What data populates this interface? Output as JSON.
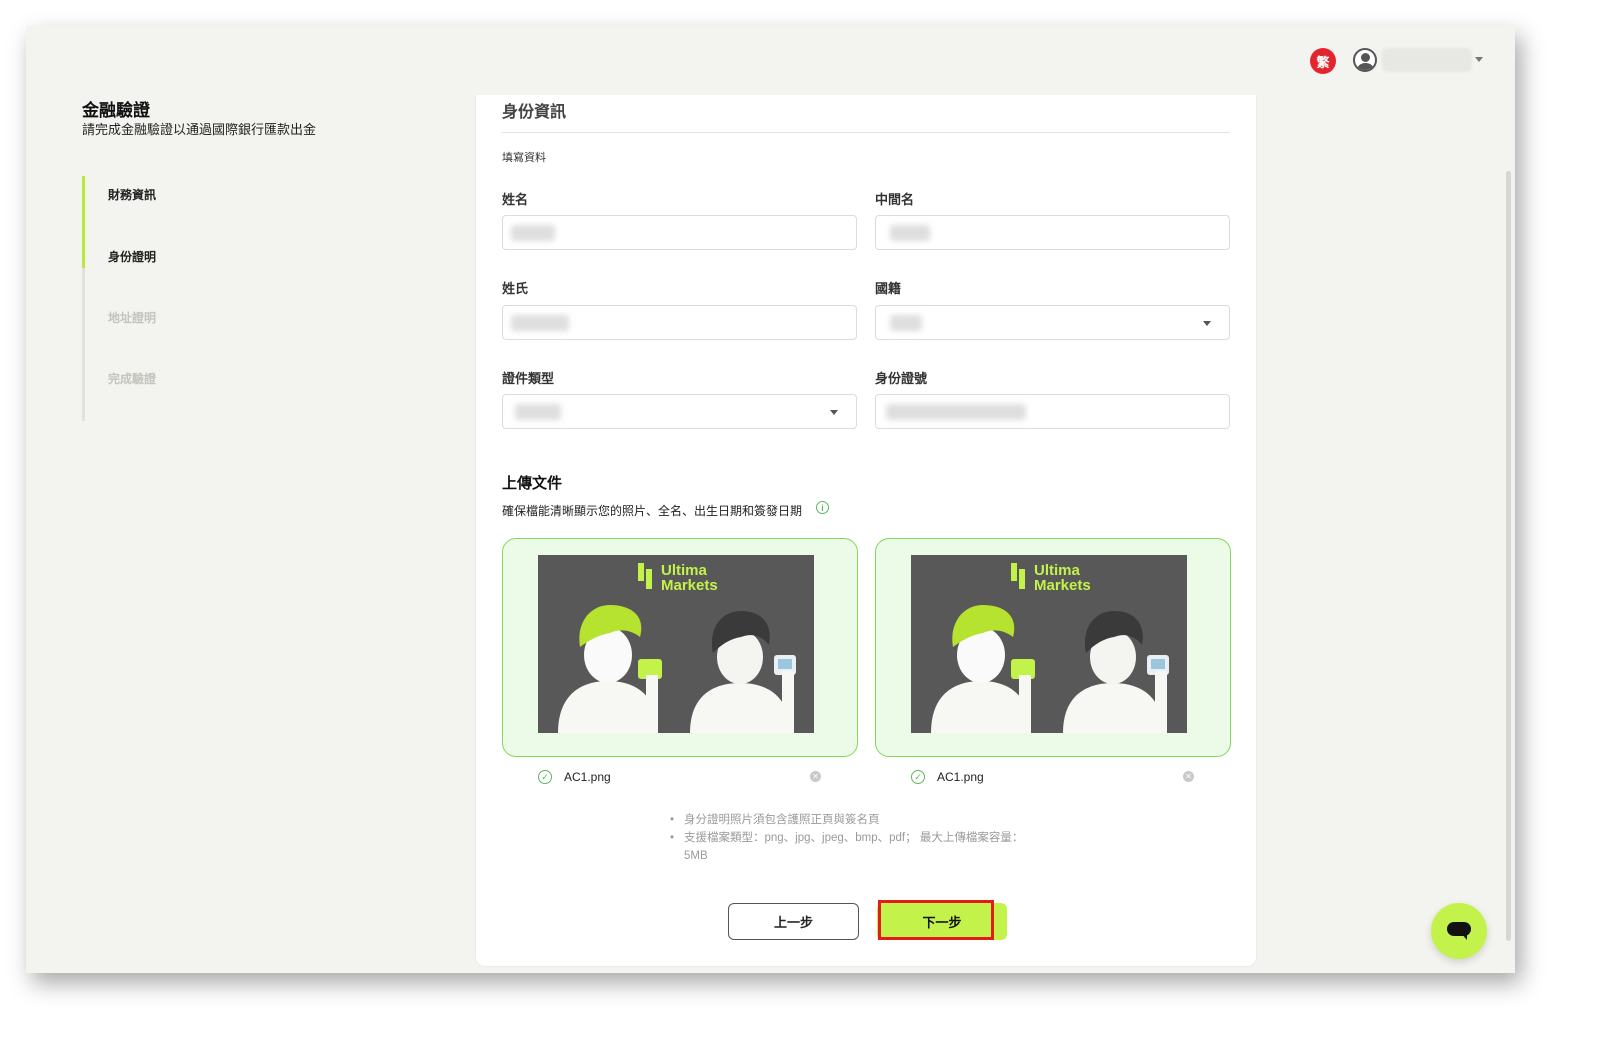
{
  "header": {
    "language_badge": "繁",
    "user_name": ""
  },
  "sidebar": {
    "title": "金融驗證",
    "subtitle": "請完成金融驗證以通過國際銀行匯款出金",
    "steps": [
      {
        "label": "財務資訊",
        "state": "done"
      },
      {
        "label": "身份證明",
        "state": "current"
      },
      {
        "label": "地址證明",
        "state": "pending"
      },
      {
        "label": "完成驗證",
        "state": "pending"
      }
    ]
  },
  "form": {
    "section_title": "身份資訊",
    "subsection": "填寫資料",
    "fields": {
      "first_name": {
        "label": "姓名",
        "value": ""
      },
      "middle_name": {
        "label": "中間名",
        "value": ""
      },
      "last_name": {
        "label": "姓氏",
        "value": ""
      },
      "nationality": {
        "label": "國籍",
        "value": ""
      },
      "id_type": {
        "label": "證件類型",
        "value": ""
      },
      "id_number": {
        "label": "身份證號",
        "value": ""
      }
    }
  },
  "upload": {
    "title": "上傳文件",
    "hint": "確保檔能清晰顯示您的照片、全名、出生日期和簽發日期",
    "info_icon": "i",
    "files": [
      {
        "name": "AC1.png",
        "logo_line1": "Ultima",
        "logo_line2": "Markets"
      },
      {
        "name": "AC1.png",
        "logo_line1": "Ultima",
        "logo_line2": "Markets"
      }
    ],
    "notes": [
      "身分證明照片須包含護照正頁與簽名頁",
      "支援檔案類型：png、jpg、jpeg、bmp、pdf； 最大上傳檔案容量：5MB"
    ]
  },
  "buttons": {
    "prev_label": "上一步",
    "next_label": "下一步"
  },
  "colors": {
    "accent": "#c3f24a",
    "upload_border": "#7ed957",
    "highlight": "#e21b1b"
  }
}
